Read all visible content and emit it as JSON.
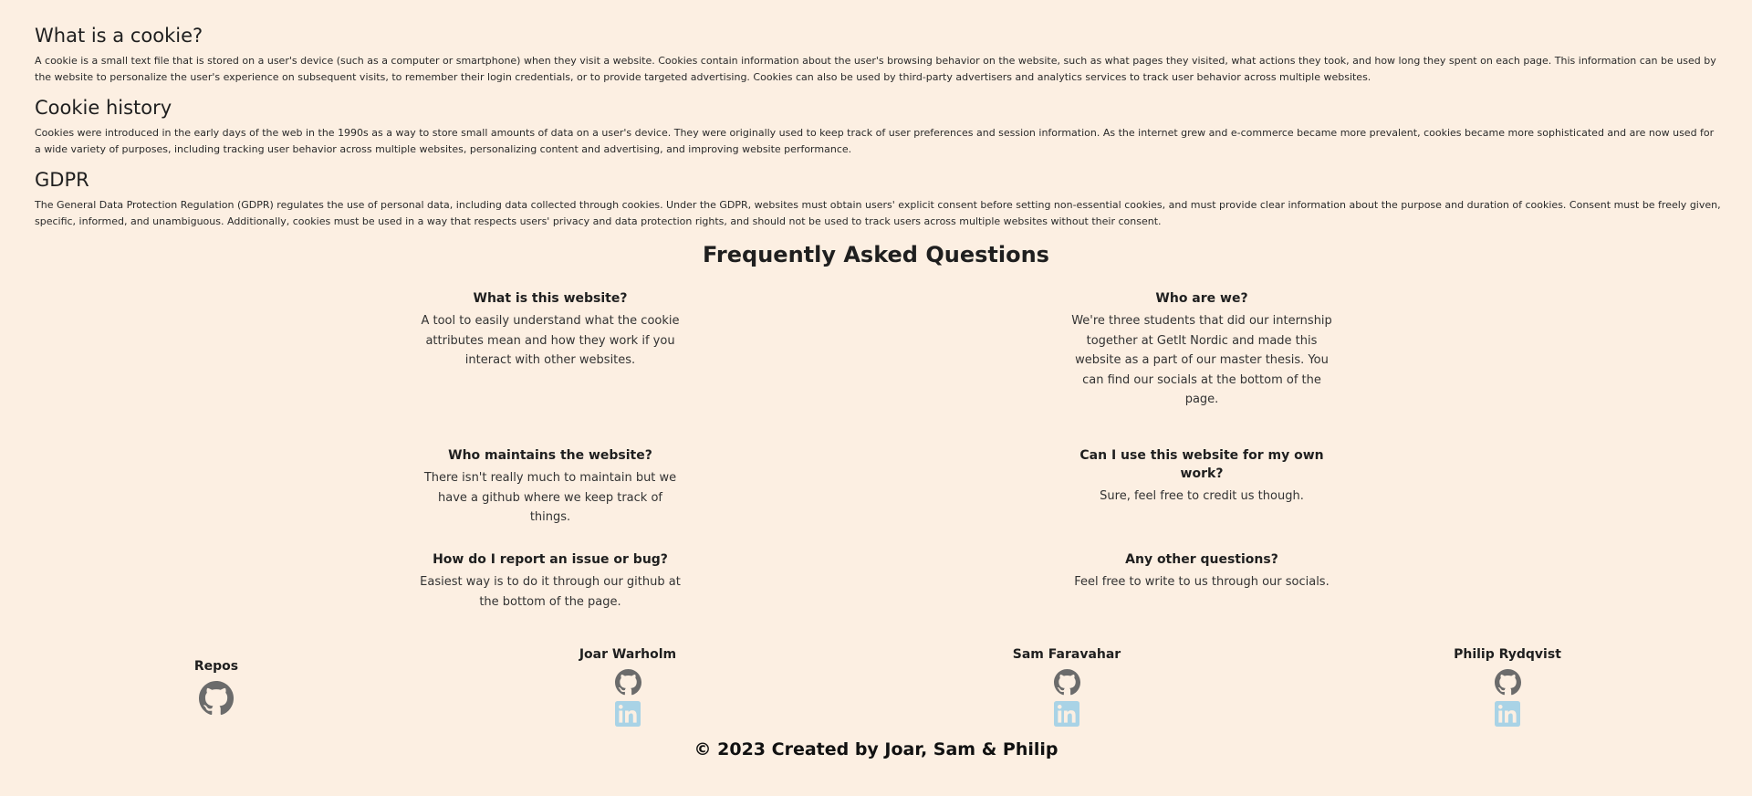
{
  "sections": [
    {
      "heading": "What is a cookie?",
      "body": "A cookie is a small text file that is stored on a user's device (such as a computer or smartphone) when they visit a website. Cookies contain information about the user's browsing behavior on the website, such as what pages they visited, what actions they took, and how long they spent on each page. This information can be used by the website to personalize the user's experience on subsequent visits, to remember their login credentials, or to provide targeted advertising. Cookies can also be used by third-party advertisers and analytics services to track user behavior across multiple websites."
    },
    {
      "heading": "Cookie history",
      "body": "Cookies were introduced in the early days of the web in the 1990s as a way to store small amounts of data on a user's device. They were originally used to keep track of user preferences and session information. As the internet grew and e-commerce became more prevalent, cookies became more sophisticated and are now used for a wide variety of purposes, including tracking user behavior across multiple websites, personalizing content and advertising, and improving website performance."
    },
    {
      "heading": "GDPR",
      "body": "The General Data Protection Regulation (GDPR) regulates the use of personal data, including data collected through cookies. Under the GDPR, websites must obtain users' explicit consent before setting non-essential cookies, and must provide clear information about the purpose and duration of cookies. Consent must be freely given, specific, informed, and unambiguous. Additionally, cookies must be used in a way that respects users' privacy and data protection rights, and should not be used to track users across multiple websites without their consent."
    }
  ],
  "faq": {
    "title": "Frequently Asked Questions",
    "items": [
      {
        "question": "What is this website?",
        "answer": "A tool to easily understand what the cookie attributes mean and how they work if you interact with other websites."
      },
      {
        "question": "Who are we?",
        "answer": "We're three students that did our internship together at GetIt Nordic and made this website as a part of our master thesis. You can find our socials at the bottom of the page."
      },
      {
        "question": "Who maintains the website?",
        "answer": "There isn't really much to maintain but we have a github where we keep track of things."
      },
      {
        "question": "Can I use this website for my own work?",
        "answer": "Sure, feel free to credit us though."
      },
      {
        "question": "How do I report an issue or bug?",
        "answer": "Easiest way is to do it through our github at the bottom of the page."
      },
      {
        "question": "Any other questions?",
        "answer": "Feel free to write to us through our socials."
      }
    ]
  },
  "footer": {
    "repos_label": "Repos",
    "people": [
      {
        "name": "Joar Warholm",
        "icons": [
          "github-icon",
          "linkedin-icon"
        ]
      },
      {
        "name": "Sam Faravahar",
        "icons": [
          "github-icon",
          "linkedin-icon"
        ]
      },
      {
        "name": "Philip Rydqvist",
        "icons": [
          "github-icon",
          "linkedin-icon"
        ]
      }
    ],
    "copyright": "© 2023 Created by Joar, Sam & Philip"
  },
  "colors": {
    "background": "#fcefe2",
    "github_icon": "#6b6b6b",
    "linkedin_icon": "#a9d3e6"
  }
}
